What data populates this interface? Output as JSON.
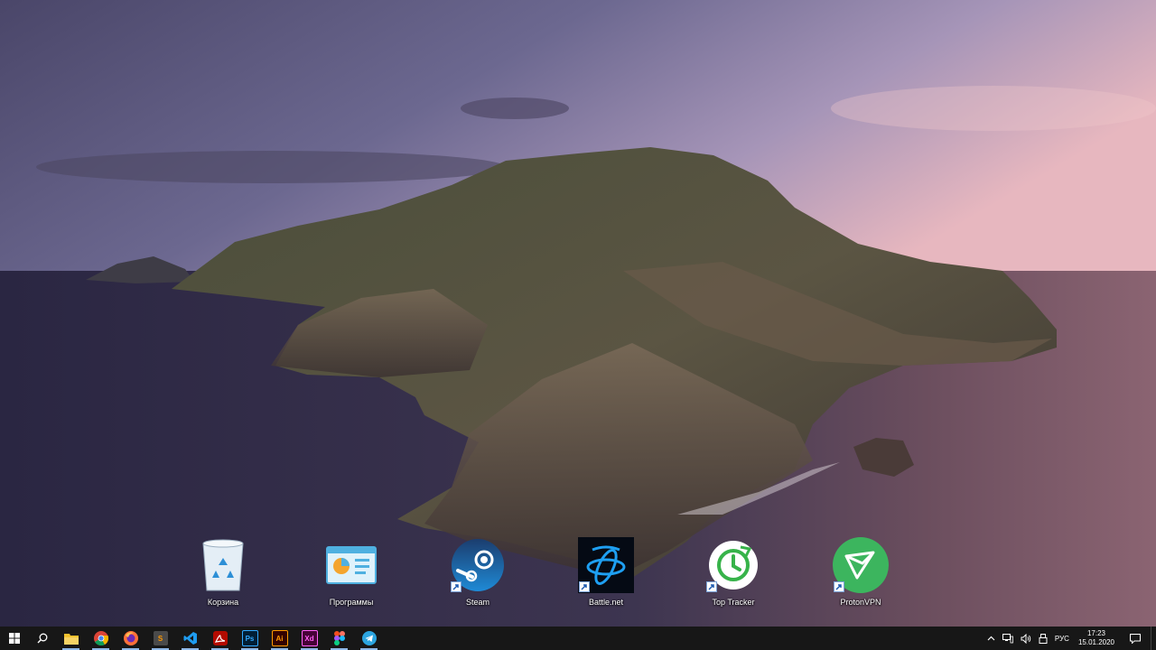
{
  "desktop": {
    "icons": [
      {
        "label": "Корзина",
        "icon": "recycle-bin-icon"
      },
      {
        "label": "Программы",
        "icon": "folder-icon"
      },
      {
        "label": "Steam",
        "icon": "steam-icon"
      },
      {
        "label": "Battle.net",
        "icon": "battlenet-icon"
      },
      {
        "label": "Top Tracker",
        "icon": "toptracker-icon"
      },
      {
        "label": "ProtonVPN",
        "icon": "protonvpn-icon"
      }
    ]
  },
  "taskbar": {
    "apps": [
      {
        "name": "file-explorer",
        "glyph": "",
        "color": "#f2c12e"
      },
      {
        "name": "chrome",
        "glyph": "",
        "color": "#4285f4"
      },
      {
        "name": "firefox",
        "glyph": "",
        "color": "#ff7139"
      },
      {
        "name": "sublime-text",
        "glyph": "S",
        "color": "#ff9800"
      },
      {
        "name": "vscode",
        "glyph": "",
        "color": "#0078d7"
      },
      {
        "name": "acrobat",
        "glyph": "",
        "color": "#e01e1e"
      },
      {
        "name": "photoshop",
        "glyph": "Ps",
        "color": "#001e36"
      },
      {
        "name": "illustrator",
        "glyph": "Ai",
        "color": "#330000"
      },
      {
        "name": "xd",
        "glyph": "Xd",
        "color": "#470137"
      },
      {
        "name": "figma",
        "glyph": "",
        "color": "#a259ff"
      },
      {
        "name": "telegram",
        "glyph": "",
        "color": "#2ca5e0"
      }
    ],
    "tray": {
      "language": "РУС",
      "time": "17:23",
      "date": "15.01.2020"
    }
  },
  "colors": {
    "taskbar_bg": "#171717",
    "running_indicator": "#8fb8e8"
  }
}
